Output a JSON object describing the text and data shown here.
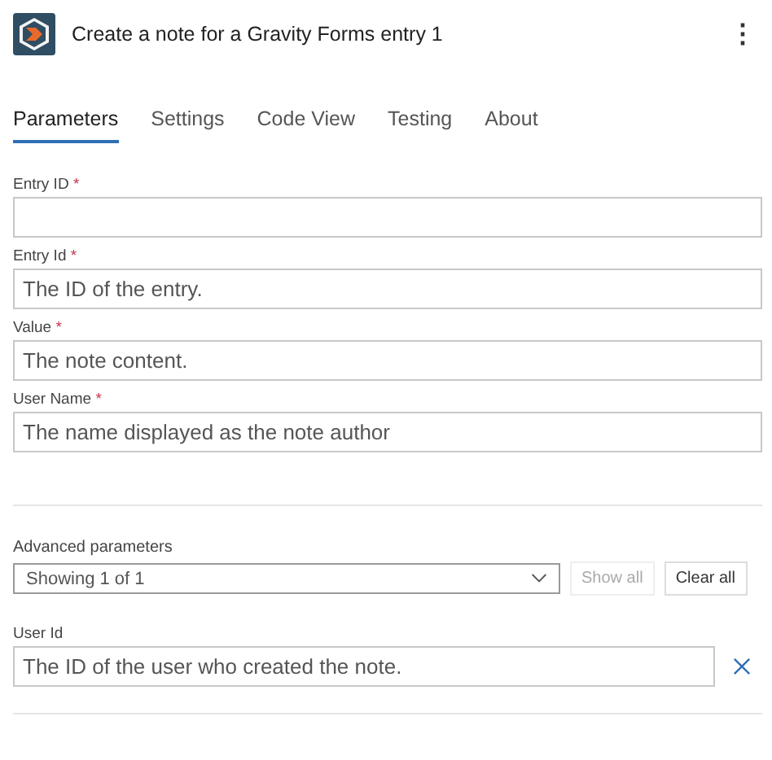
{
  "header": {
    "title": "Create a note for a Gravity Forms entry 1",
    "menu_icon": "⋮"
  },
  "tabs": [
    {
      "label": "Parameters",
      "selected": true
    },
    {
      "label": "Settings",
      "selected": false
    },
    {
      "label": "Code View",
      "selected": false
    },
    {
      "label": "Testing",
      "selected": false
    },
    {
      "label": "About",
      "selected": false
    }
  ],
  "fields": [
    {
      "label": "Entry ID",
      "required_mark": "*"
    },
    {
      "label": "Entry Id",
      "required_mark": "*",
      "placeholder": "The ID of the entry."
    },
    {
      "label": "Value",
      "required_mark": "*",
      "placeholder": "The note content."
    },
    {
      "label": "User Name",
      "required_mark": "*",
      "placeholder": "The name displayed as the note author"
    }
  ],
  "advanced": {
    "label": "Advanced parameters",
    "dropdown": "Showing 1 of 1",
    "buttons": [
      {
        "label": "Show all",
        "disabled": true
      },
      {
        "label": "Clear all",
        "disabled": false
      }
    ]
  },
  "advanced_fields": [
    {
      "label": "User Id",
      "placeholder": "The ID of the user who created the note."
    }
  ]
}
